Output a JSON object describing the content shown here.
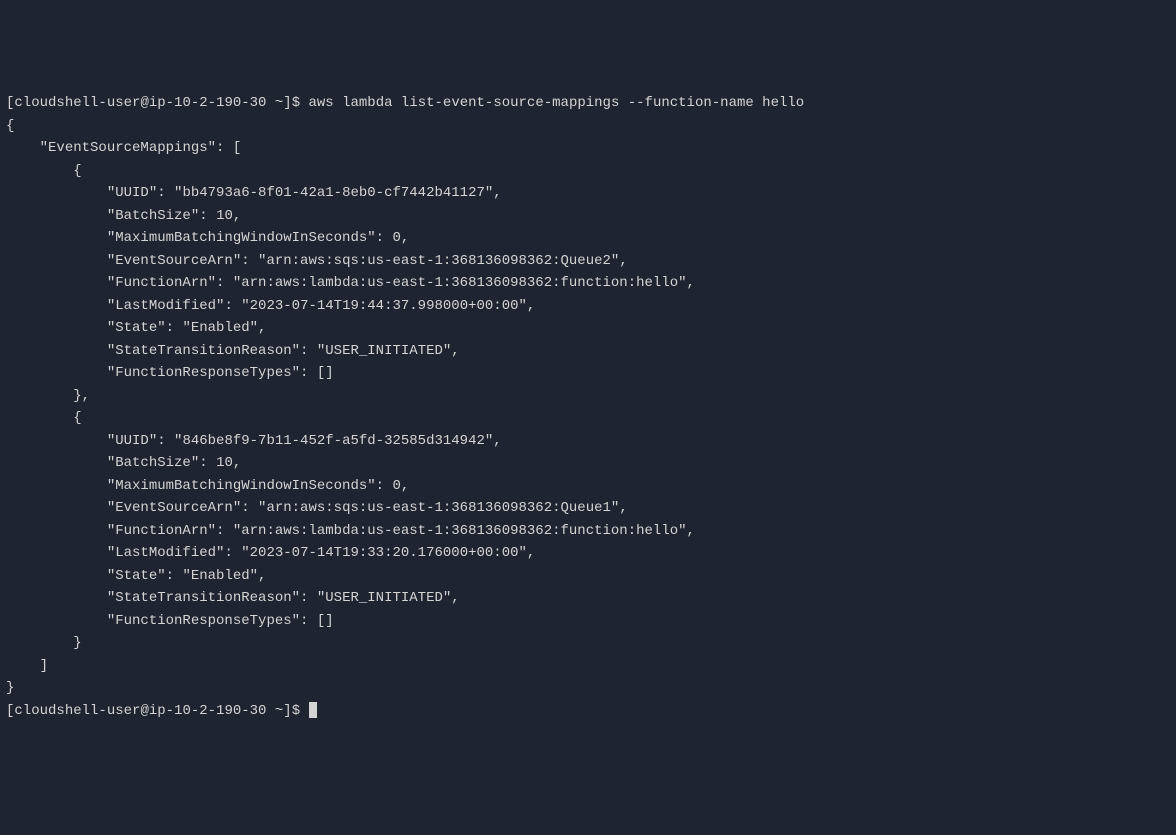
{
  "prompt1": {
    "user": "cloudshell-user",
    "host": "ip-10-2-190-30",
    "cwd": "~",
    "symbol": "$",
    "command": "aws lambda list-event-source-mappings --function-name hello"
  },
  "output": {
    "rootOpen": "{",
    "key_esm": "EventSourceMappings",
    "arrOpen": "[",
    "items": [
      {
        "UUID": "bb4793a6-8f01-42a1-8eb0-cf7442b41127",
        "BatchSize": "10",
        "MaximumBatchingWindowInSeconds": "0",
        "EventSourceArn": "arn:aws:sqs:us-east-1:368136098362:Queue2",
        "FunctionArn": "arn:aws:lambda:us-east-1:368136098362:function:hello",
        "LastModified": "2023-07-14T19:44:37.998000+00:00",
        "State": "Enabled",
        "StateTransitionReason": "USER_INITIATED",
        "FunctionResponseTypes": "[]"
      },
      {
        "UUID": "846be8f9-7b11-452f-a5fd-32585d314942",
        "BatchSize": "10",
        "MaximumBatchingWindowInSeconds": "0",
        "EventSourceArn": "arn:aws:sqs:us-east-1:368136098362:Queue1",
        "FunctionArn": "arn:aws:lambda:us-east-1:368136098362:function:hello",
        "LastModified": "2023-07-14T19:33:20.176000+00:00",
        "State": "Enabled",
        "StateTransitionReason": "USER_INITIATED",
        "FunctionResponseTypes": "[]"
      }
    ],
    "arrClose": "]",
    "rootClose": "}"
  },
  "prompt2": {
    "user": "cloudshell-user",
    "host": "ip-10-2-190-30",
    "cwd": "~",
    "symbol": "$"
  },
  "labels": {
    "UUID": "UUID",
    "BatchSize": "BatchSize",
    "MaximumBatchingWindowInSeconds": "MaximumBatchingWindowInSeconds",
    "EventSourceArn": "EventSourceArn",
    "FunctionArn": "FunctionArn",
    "LastModified": "LastModified",
    "State": "State",
    "StateTransitionReason": "StateTransitionReason",
    "FunctionResponseTypes": "FunctionResponseTypes"
  }
}
